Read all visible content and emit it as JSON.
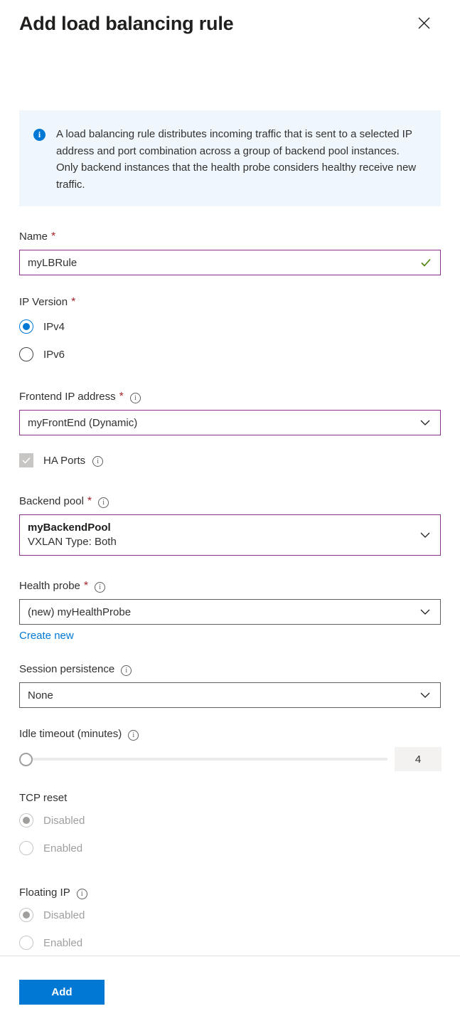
{
  "header": {
    "title": "Add load balancing rule",
    "close_icon": "close-icon"
  },
  "banner": {
    "icon": "info-icon",
    "text": "A load balancing rule distributes incoming traffic that is sent to a selected IP address and port combination across a group of backend pool instances. Only backend instances that the health probe considers healthy receive new traffic."
  },
  "fields": {
    "name": {
      "label": "Name",
      "required_marker": "*",
      "value": "myLBRule",
      "valid_icon": "checkmark-icon"
    },
    "ip_version": {
      "label": "IP Version",
      "required_marker": "*",
      "options": [
        {
          "label": "IPv4",
          "selected": true
        },
        {
          "label": "IPv6",
          "selected": false
        }
      ]
    },
    "frontend_ip": {
      "label": "Frontend IP address",
      "required_marker": "*",
      "info_icon": "info-tooltip-icon",
      "value": "myFrontEnd (Dynamic)",
      "chevron": "chevron-down-icon"
    },
    "ha_ports": {
      "label": "HA Ports",
      "checked": true,
      "disabled": true,
      "info_icon": "info-tooltip-icon"
    },
    "backend_pool": {
      "label": "Backend pool",
      "required_marker": "*",
      "info_icon": "info-tooltip-icon",
      "value_primary": "myBackendPool",
      "value_secondary": "VXLAN Type: Both",
      "chevron": "chevron-down-icon"
    },
    "health_probe": {
      "label": "Health probe",
      "required_marker": "*",
      "info_icon": "info-tooltip-icon",
      "value": "(new) myHealthProbe",
      "chevron": "chevron-down-icon",
      "create_new_link": "Create new"
    },
    "session_persistence": {
      "label": "Session persistence",
      "info_icon": "info-tooltip-icon",
      "value": "None",
      "chevron": "chevron-down-icon"
    },
    "idle_timeout": {
      "label": "Idle timeout (minutes)",
      "info_icon": "info-tooltip-icon",
      "value": "4",
      "min": 4,
      "max": 30
    },
    "tcp_reset": {
      "label": "TCP reset",
      "disabled": true,
      "options": [
        {
          "label": "Disabled",
          "selected": true
        },
        {
          "label": "Enabled",
          "selected": false
        }
      ]
    },
    "floating_ip": {
      "label": "Floating IP",
      "info_icon": "info-tooltip-icon",
      "disabled": true,
      "options": [
        {
          "label": "Disabled",
          "selected": true
        },
        {
          "label": "Enabled",
          "selected": false
        }
      ]
    }
  },
  "footer": {
    "add_label": "Add"
  },
  "colors": {
    "accent": "#0078d4",
    "banner_bg": "#eff6fc",
    "required": "#a4262c",
    "valid_border": "#8a2f8a",
    "valid_check": "#498205",
    "disabled_text": "#a19f9d"
  }
}
